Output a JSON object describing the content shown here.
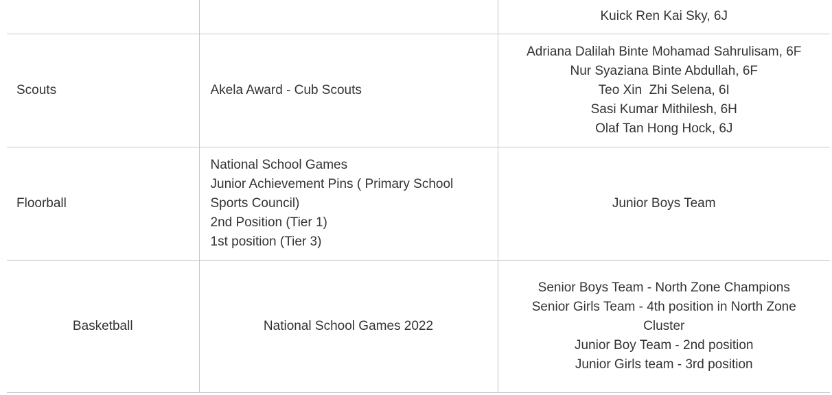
{
  "table": {
    "rows": [
      {
        "activity": "",
        "achievement": [],
        "awardees": [
          "Kuick Ren Kai Sky, 6J"
        ]
      },
      {
        "activity": "Scouts",
        "achievement": [
          "Akela Award - Cub Scouts"
        ],
        "awardees": [
          "Adriana Dalilah Binte Mohamad Sahrulisam, 6F",
          "Nur Syaziana Binte Abdullah, 6F",
          "Teo Xin  Zhi Selena, 6I",
          "Sasi Kumar Mithilesh, 6H",
          "Olaf Tan Hong Hock, 6J"
        ]
      },
      {
        "activity": "Floorball",
        "achievement": [
          "National School Games",
          "Junior Achievement Pins ( Primary School Sports Council)",
          "2nd Position (Tier 1)",
          "1st position (Tier 3)"
        ],
        "awardees": [
          "Junior Boys Team"
        ]
      },
      {
        "activity": "Basketball",
        "achievement": [
          "National School Games 2022"
        ],
        "awardees": [
          "Senior Boys Team - North Zone Champions",
          "Senior Girls Team - 4th position in North Zone Cluster",
          "Junior Boy Team - 2nd position",
          "Junior Girls team - 3rd position"
        ]
      }
    ]
  }
}
